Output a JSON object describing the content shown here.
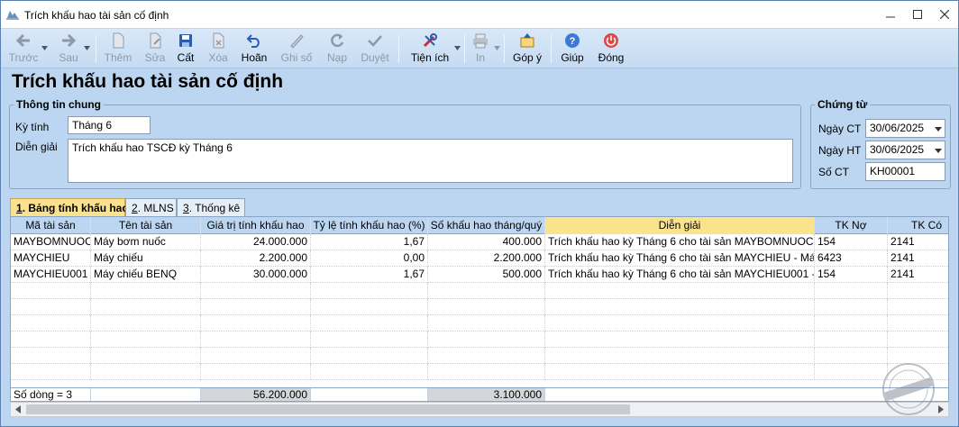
{
  "window": {
    "title": "Trích khấu hao tài sản cố định"
  },
  "toolbar": {
    "buttons": [
      {
        "label": "Trước",
        "icon": "arrow-left-icon"
      },
      {
        "label": "Sau",
        "icon": "arrow-right-icon"
      },
      {
        "label": "Thêm",
        "icon": "new-document-icon"
      },
      {
        "label": "Sửa",
        "icon": "edit-document-icon"
      },
      {
        "label": "Cất",
        "icon": "save-icon"
      },
      {
        "label": "Xóa",
        "icon": "delete-icon"
      },
      {
        "label": "Hoãn",
        "icon": "undo-icon"
      },
      {
        "label": "Ghi sổ",
        "icon": "pencil-icon"
      },
      {
        "label": "Nạp",
        "icon": "refresh-icon"
      },
      {
        "label": "Duyệt",
        "icon": "check-icon"
      },
      {
        "label": "Tiện ích",
        "icon": "tools-icon"
      },
      {
        "label": "In",
        "icon": "printer-icon"
      },
      {
        "label": "Góp ý",
        "icon": "feedback-icon"
      },
      {
        "label": "Giúp",
        "icon": "help-icon"
      },
      {
        "label": "Đóng",
        "icon": "power-icon"
      }
    ]
  },
  "heading": "Trích khấu hao tài sản cố định",
  "general": {
    "legend": "Thông tin chung",
    "period_label": "Kỳ tính",
    "period_value": "Tháng 6",
    "description_label": "Diễn giải",
    "description_value": "Trích khấu hao TSCĐ kỳ Tháng 6"
  },
  "voucher": {
    "legend": "Chứng từ",
    "date_ct_label": "Ngày CT",
    "date_ct_value": "30/06/2025",
    "date_ht_label": "Ngày HT",
    "date_ht_value": "30/06/2025",
    "number_label": "Số CT",
    "number_value": "KH00001"
  },
  "tabs": [
    {
      "key": "1",
      "label": ". Bảng tính khấu hao"
    },
    {
      "key": "2",
      "label": ". MLNS"
    },
    {
      "key": "3",
      "label": ". Thống kê"
    }
  ],
  "table": {
    "columns": [
      "Mã tài sản",
      "Tên tài sản",
      "Giá trị tính khấu hao",
      "Tỷ lệ tính khấu hao (%)",
      "Số khấu hao tháng/quý",
      "Diễn giải",
      "TK Nợ",
      "TK Có"
    ],
    "rows": [
      [
        "MAYBOMNUOC...",
        "Máy bơm nuốc",
        "24.000.000",
        "1,67",
        "400.000",
        "Trích khấu hao kỳ Tháng 6 cho tài sản MAYBOMNUOC0...",
        "154",
        "2141"
      ],
      [
        "MAYCHIEU",
        "Máy chiếu",
        "2.200.000",
        "0,00",
        "2.200.000",
        "Trích khấu hao kỳ Tháng 6 cho tài sản MAYCHIEU - Máy...",
        "6423",
        "2141"
      ],
      [
        "MAYCHIEU001",
        "Máy chiếu BENQ",
        "30.000.000",
        "1,67",
        "500.000",
        "Trích khấu hao kỳ Tháng 6 cho tài sản MAYCHIEU001 -...",
        "154",
        "2141"
      ]
    ],
    "footer": {
      "row_count": "Số dòng = 3",
      "total_value": "56.200.000",
      "total_depreciation": "3.100.000"
    }
  },
  "colors": {
    "window_bg": "#bcd6f2",
    "active_tab": "#fbe28d",
    "title_bar": "#ffffff"
  }
}
